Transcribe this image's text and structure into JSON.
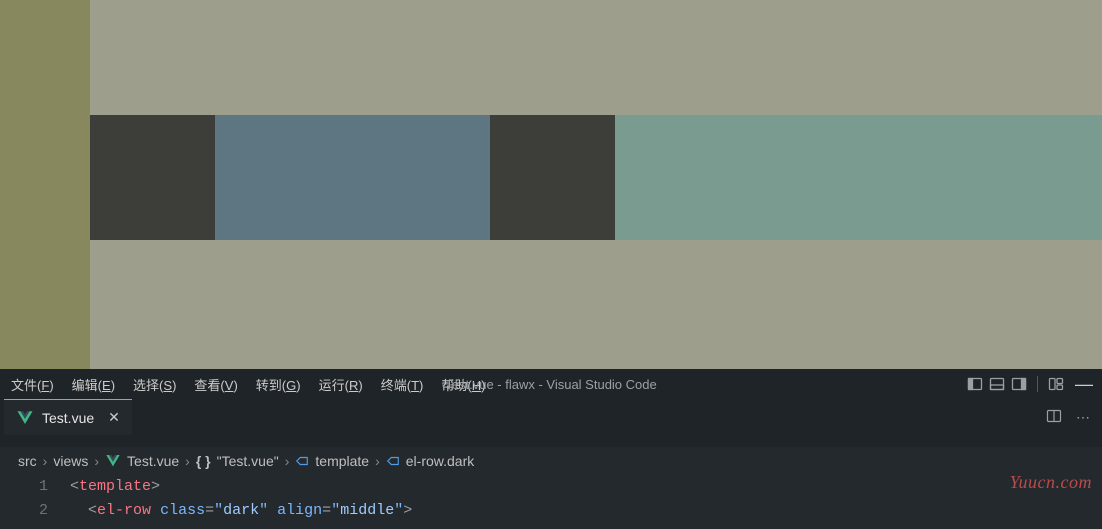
{
  "preview": {
    "columns": [
      "dark-a",
      "light-blue",
      "dark-b",
      "light-green"
    ]
  },
  "menu": {
    "items": [
      {
        "label": "文件",
        "mnemonic": "F"
      },
      {
        "label": "编辑",
        "mnemonic": "E"
      },
      {
        "label": "选择",
        "mnemonic": "S"
      },
      {
        "label": "查看",
        "mnemonic": "V"
      },
      {
        "label": "转到",
        "mnemonic": "G"
      },
      {
        "label": "运行",
        "mnemonic": "R"
      },
      {
        "label": "终端",
        "mnemonic": "T"
      },
      {
        "label": "帮助",
        "mnemonic": "H"
      }
    ]
  },
  "window": {
    "title": "Test.vue - flawx - Visual Studio Code"
  },
  "tab": {
    "filename": "Test.vue",
    "icon": "vue-icon"
  },
  "breadcrumb": {
    "parts": [
      {
        "type": "folder",
        "label": "src"
      },
      {
        "type": "folder",
        "label": "views"
      },
      {
        "type": "file",
        "label": "Test.vue",
        "icon": "vue-icon"
      },
      {
        "type": "symbol",
        "label": "\"Test.vue\"",
        "icon": "braces"
      },
      {
        "type": "symbol",
        "label": "template",
        "icon": "element"
      },
      {
        "type": "symbol",
        "label": "el-row.dark",
        "icon": "element"
      }
    ]
  },
  "code": {
    "lines": [
      {
        "num": "1",
        "indent": 0,
        "raw": "<template>"
      },
      {
        "num": "2",
        "indent": 1,
        "raw": "<el-row class=\"dark\" align=\"middle\">"
      }
    ],
    "tokens": {
      "lt": "<",
      "gt": ">",
      "slash": "/",
      "template": "template",
      "elrow": "el-row",
      "class": "class",
      "align": "align",
      "eq": "=",
      "q": "\"",
      "dark": "dark",
      "middle": "middle"
    }
  },
  "watermark": "Yuucn.com"
}
